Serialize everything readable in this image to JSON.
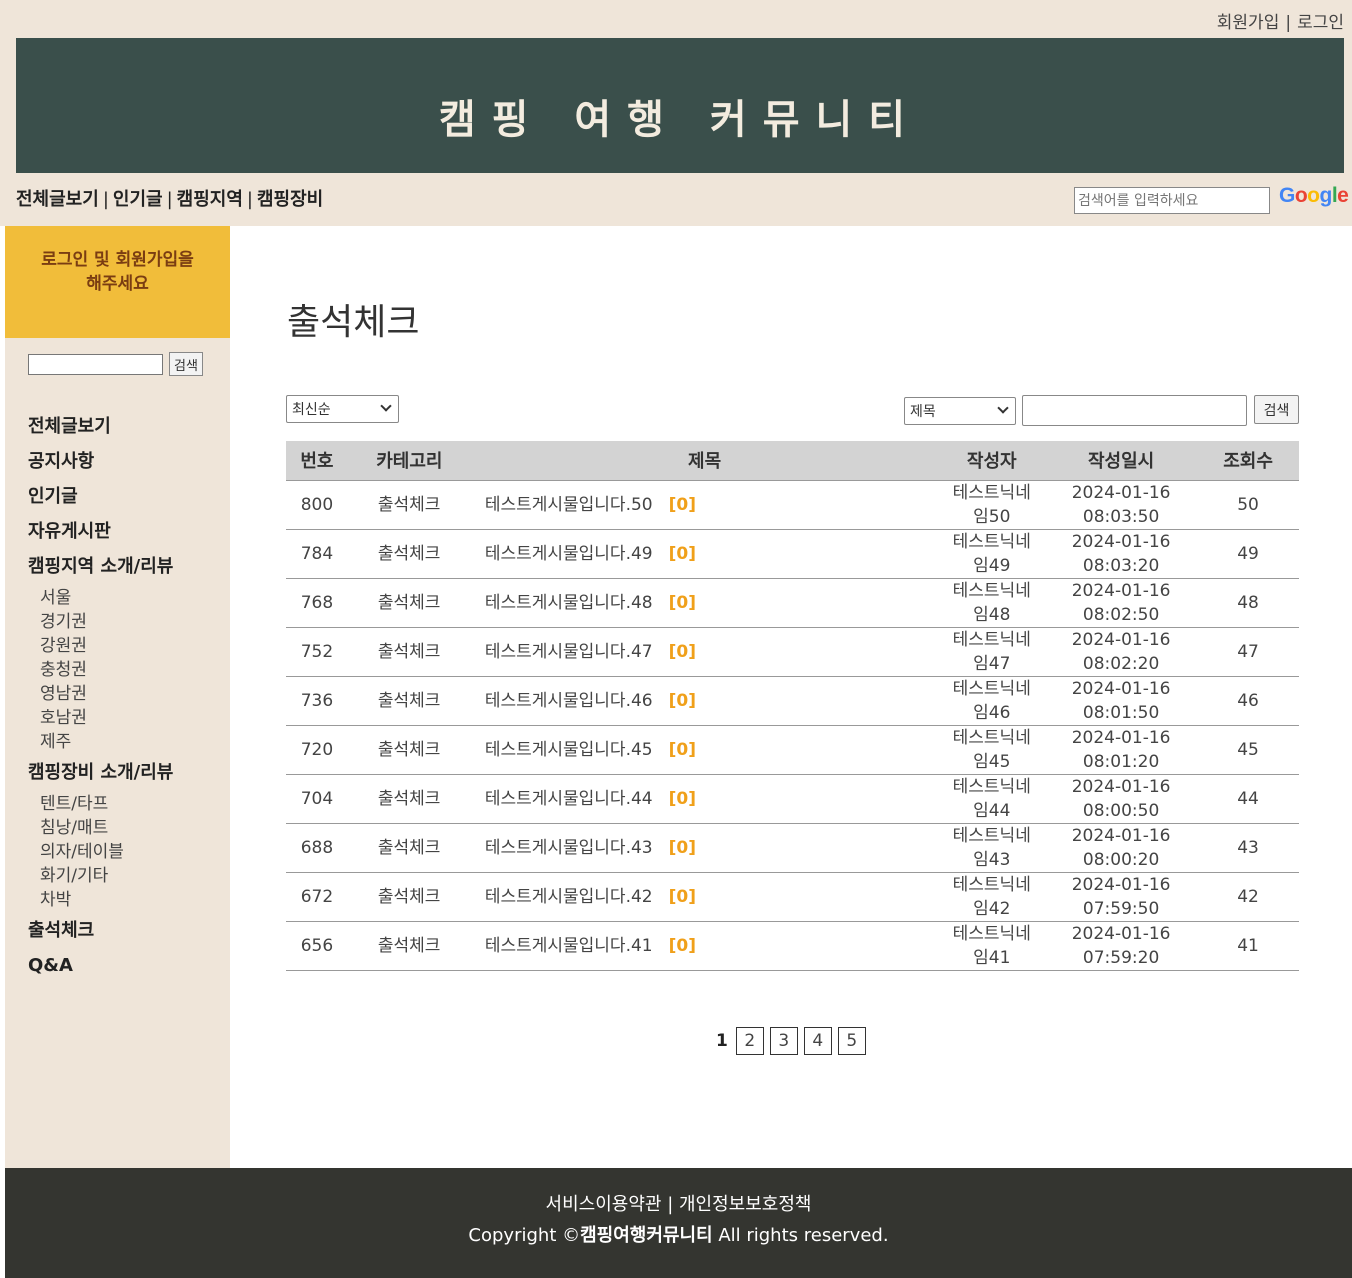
{
  "top_links": {
    "signup": "회원가입",
    "login": "로그인",
    "separator": "|"
  },
  "site_title": "캠핑 여행 커뮤니티",
  "main_nav": [
    "전체글보기",
    "인기글",
    "캠핑지역",
    "캠핑장비"
  ],
  "google_search": {
    "placeholder": "검색어를 입력하세요",
    "logo_letters": [
      "G",
      "o",
      "o",
      "g",
      "l",
      "e"
    ],
    "logo_colors": [
      "#4285f4",
      "#ea4335",
      "#fbbc05",
      "#4285f4",
      "#34a853",
      "#ea4335"
    ]
  },
  "sidebar": {
    "login_prompt_line1": "로그인 및 회원가입을",
    "login_prompt_line2": "해주세요",
    "search_button": "검색",
    "menu": [
      {
        "label": "전체글보기",
        "sub": []
      },
      {
        "label": "공지사항",
        "sub": []
      },
      {
        "label": "인기글",
        "sub": []
      },
      {
        "label": "자유게시판",
        "sub": []
      },
      {
        "label": "캠핑지역 소개/리뷰",
        "sub": [
          "서울",
          "경기권",
          "강원권",
          "충청권",
          "영남권",
          "호남권",
          "제주"
        ]
      },
      {
        "label": "캠핑장비 소개/리뷰",
        "sub": [
          "텐트/타프",
          "침낭/매트",
          "의자/테이블",
          "화기/기타",
          "차박"
        ]
      },
      {
        "label": "출석체크",
        "sub": []
      },
      {
        "label": "Q&A",
        "sub": []
      }
    ]
  },
  "board": {
    "title": "출석체크",
    "sort_select": "최신순",
    "field_select": "제목",
    "search_button": "검색",
    "columns": [
      "번호",
      "카테고리",
      "제목",
      "작성자",
      "작성일시",
      "조회수"
    ],
    "rows": [
      {
        "num": "800",
        "cat": "출석체크",
        "title": "테스트게시물입니다.50",
        "cmt": "[0]",
        "writer1": "테스트닉네",
        "writer2": "임50",
        "date": "2024-01-16",
        "time": "08:03:50",
        "views": "50"
      },
      {
        "num": "784",
        "cat": "출석체크",
        "title": "테스트게시물입니다.49",
        "cmt": "[0]",
        "writer1": "테스트닉네",
        "writer2": "임49",
        "date": "2024-01-16",
        "time": "08:03:20",
        "views": "49"
      },
      {
        "num": "768",
        "cat": "출석체크",
        "title": "테스트게시물입니다.48",
        "cmt": "[0]",
        "writer1": "테스트닉네",
        "writer2": "임48",
        "date": "2024-01-16",
        "time": "08:02:50",
        "views": "48"
      },
      {
        "num": "752",
        "cat": "출석체크",
        "title": "테스트게시물입니다.47",
        "cmt": "[0]",
        "writer1": "테스트닉네",
        "writer2": "임47",
        "date": "2024-01-16",
        "time": "08:02:20",
        "views": "47"
      },
      {
        "num": "736",
        "cat": "출석체크",
        "title": "테스트게시물입니다.46",
        "cmt": "[0]",
        "writer1": "테스트닉네",
        "writer2": "임46",
        "date": "2024-01-16",
        "time": "08:01:50",
        "views": "46"
      },
      {
        "num": "720",
        "cat": "출석체크",
        "title": "테스트게시물입니다.45",
        "cmt": "[0]",
        "writer1": "테스트닉네",
        "writer2": "임45",
        "date": "2024-01-16",
        "time": "08:01:20",
        "views": "45"
      },
      {
        "num": "704",
        "cat": "출석체크",
        "title": "테스트게시물입니다.44",
        "cmt": "[0]",
        "writer1": "테스트닉네",
        "writer2": "임44",
        "date": "2024-01-16",
        "time": "08:00:50",
        "views": "44"
      },
      {
        "num": "688",
        "cat": "출석체크",
        "title": "테스트게시물입니다.43",
        "cmt": "[0]",
        "writer1": "테스트닉네",
        "writer2": "임43",
        "date": "2024-01-16",
        "time": "08:00:20",
        "views": "43"
      },
      {
        "num": "672",
        "cat": "출석체크",
        "title": "테스트게시물입니다.42",
        "cmt": "[0]",
        "writer1": "테스트닉네",
        "writer2": "임42",
        "date": "2024-01-16",
        "time": "07:59:50",
        "views": "42"
      },
      {
        "num": "656",
        "cat": "출석체크",
        "title": "테스트게시물입니다.41",
        "cmt": "[0]",
        "writer1": "테스트닉네",
        "writer2": "임41",
        "date": "2024-01-16",
        "time": "07:59:20",
        "views": "41"
      }
    ],
    "pagination": {
      "current": "1",
      "pages": [
        "2",
        "3",
        "4",
        "5"
      ]
    }
  },
  "footer": {
    "links": "서비스이용약관 | 개인정보보호정책",
    "copy_prefix": "Copyright ©",
    "copy_brand": "캠핑여행커뮤니티",
    "copy_suffix": " All rights reserved."
  },
  "colors": {
    "banner": "#3a4f4b",
    "beige": "#efe5d9",
    "login_box": "#f1bd3a",
    "footer": "#343530",
    "comment": "#f0a01a"
  }
}
